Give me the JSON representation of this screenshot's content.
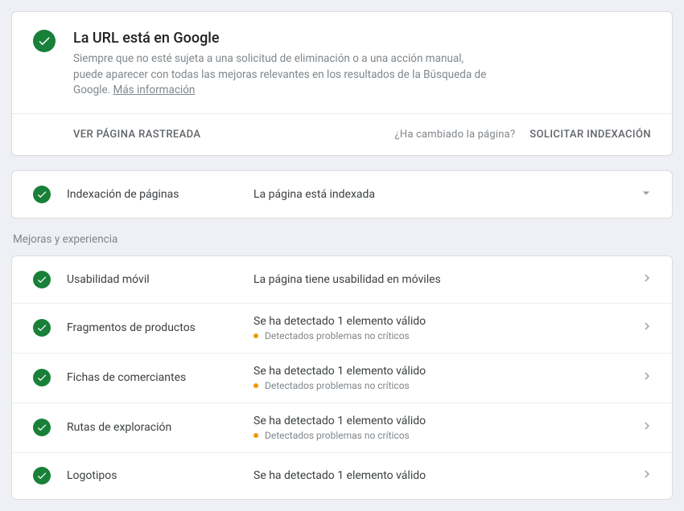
{
  "hero": {
    "title": "La URL está en Google",
    "desc_part1": "Siempre que no esté sujeta a una solicitud de eliminación o a una acción manual, puede aparecer con todas las mejoras relevantes en los resultados de la Búsqueda de Google. ",
    "more_label": "Más información",
    "action_view": "VER PÁGINA RASTREADA",
    "changed_question": "¿Ha cambiado la página?",
    "action_request": "SOLICITAR INDEXACIÓN"
  },
  "index_row": {
    "label": "Indexación de páginas",
    "status": "La página está indexada"
  },
  "section_title": "Mejoras y experiencia",
  "rows": [
    {
      "label": "Usabilidad móvil",
      "status": "La página tiene usabilidad en móviles",
      "sub": null
    },
    {
      "label": "Fragmentos de productos",
      "status": "Se ha detectado 1 elemento válido",
      "sub": "Detectados problemas no críticos"
    },
    {
      "label": "Fichas de comerciantes",
      "status": "Se ha detectado 1 elemento válido",
      "sub": "Detectados problemas no críticos"
    },
    {
      "label": "Rutas de exploración",
      "status": "Se ha detectado 1 elemento válido",
      "sub": "Detectados problemas no críticos"
    },
    {
      "label": "Logotipos",
      "status": "Se ha detectado 1 elemento válido",
      "sub": null
    }
  ]
}
